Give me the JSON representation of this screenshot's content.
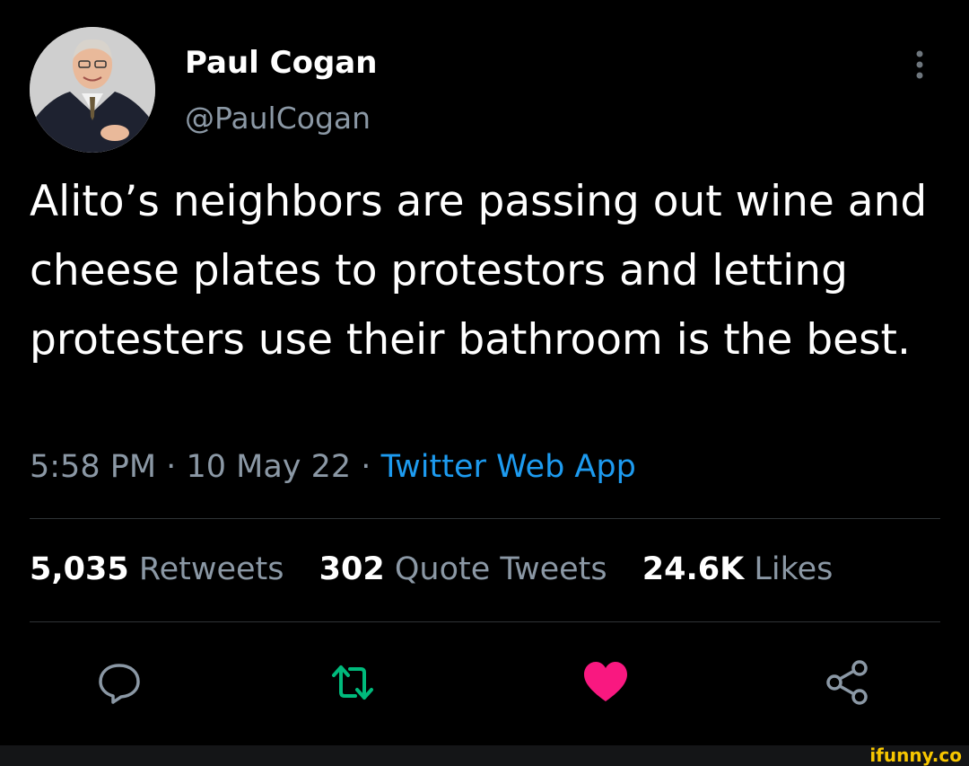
{
  "author": {
    "display_name": "Paul Cogan",
    "handle": "@PaulCogan"
  },
  "tweet": {
    "text": "Alito’s neighbors are passing out wine and cheese plates to protestors and letting protesters use their bathroom is the best.",
    "time": "5:58 PM",
    "separator": "·",
    "date": "10 May 22",
    "source": "Twitter Web App"
  },
  "stats": {
    "retweets_count": "5,035",
    "retweets_label": "Retweets",
    "quotes_count": "302",
    "quotes_label": "Quote Tweets",
    "likes_count": "24.6K",
    "likes_label": "Likes"
  },
  "actions": {
    "reply_icon": "reply-bubble-icon",
    "retweet_icon": "retweet-arrows-icon",
    "like_icon": "heart-icon",
    "share_icon": "share-icon"
  },
  "colors": {
    "background": "#000000",
    "text_primary": "#ffffff",
    "text_secondary": "#8b98a5",
    "link": "#1d9bf0",
    "retweet_active": "#00ba7c",
    "like_active": "#f91880",
    "divider": "#2f3336"
  },
  "watermark": {
    "text": "ifunny.co"
  }
}
